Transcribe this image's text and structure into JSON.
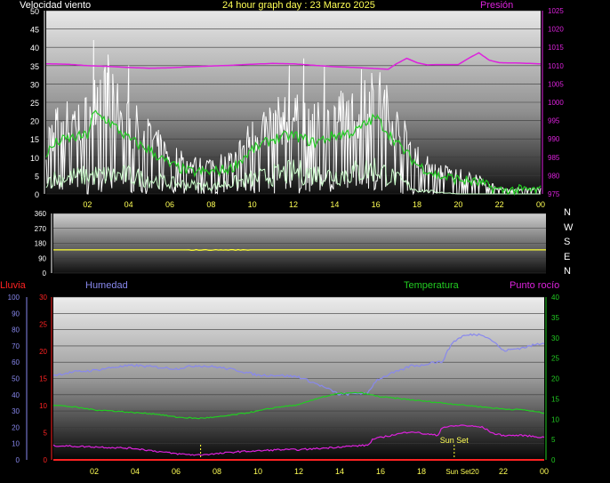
{
  "header": {
    "left": "Velocidad viento",
    "center": "24 hour graph day : 23 Marzo 2025",
    "right": "Presión"
  },
  "direction_letters": [
    "N",
    "W",
    "S",
    "E",
    "N"
  ],
  "bottom_labels": {
    "rain": "Lluvia",
    "humidity": "Humedad",
    "temperature": "Temperatura",
    "dewpoint": "Punto rocío",
    "sunset": "Sun Set",
    "sunset_axis": "Sun Set20"
  },
  "colors": {
    "wind_gust": "#ffffff",
    "wind_avg": "#22cc22",
    "wind_low": "#ccffcc",
    "pressure": "#dd22dd",
    "direction": "#ffff33",
    "humidity": "#8888ee",
    "temperature": "#22cc22",
    "dewpoint": "#dd22dd",
    "rain": "#ff2222"
  },
  "chart_data": [
    {
      "type": "line",
      "name": "wind-pressure",
      "x_ticks": [
        "02",
        "04",
        "06",
        "08",
        "10",
        "12",
        "14",
        "16",
        "18",
        "20",
        "22",
        "00"
      ],
      "y_left_ticks": [
        "0",
        "5",
        "10",
        "15",
        "20",
        "25",
        "30",
        "35",
        "40",
        "45",
        "50"
      ],
      "y_left_range": [
        0,
        50
      ],
      "y_right_ticks": [
        "975",
        "980",
        "985",
        "990",
        "995",
        "1000",
        "1005",
        "1010",
        "1015",
        "1020",
        "1025"
      ],
      "y_right_range": [
        975,
        1025
      ],
      "x_range": [
        0,
        24
      ],
      "gust_peaks": [
        [
          2.3,
          42
        ],
        [
          3.0,
          38
        ],
        [
          4.0,
          35
        ],
        [
          11.8,
          35
        ],
        [
          12.5,
          37
        ],
        [
          13.5,
          35
        ],
        [
          15.3,
          34
        ],
        [
          15.8,
          33
        ]
      ],
      "wind_avg": [
        [
          0,
          11
        ],
        [
          0.5,
          14
        ],
        [
          1,
          15
        ],
        [
          2,
          16
        ],
        [
          2.3,
          22
        ],
        [
          3,
          20
        ],
        [
          4,
          15
        ],
        [
          5,
          12
        ],
        [
          6,
          8
        ],
        [
          7,
          6
        ],
        [
          8,
          6
        ],
        [
          9,
          7
        ],
        [
          10,
          12
        ],
        [
          11,
          15
        ],
        [
          12,
          16
        ],
        [
          13,
          14
        ],
        [
          14,
          16
        ],
        [
          15,
          17
        ],
        [
          16,
          21
        ],
        [
          17,
          14
        ],
        [
          18,
          8
        ],
        [
          19,
          5
        ],
        [
          20,
          4
        ],
        [
          21,
          3
        ],
        [
          22,
          1
        ],
        [
          23,
          1
        ],
        [
          24,
          1
        ]
      ],
      "wind_low": [
        [
          0,
          4
        ],
        [
          2,
          5
        ],
        [
          4,
          5
        ],
        [
          6,
          3
        ],
        [
          8,
          2
        ],
        [
          10,
          4
        ],
        [
          12,
          6
        ],
        [
          14,
          5
        ],
        [
          16,
          7
        ],
        [
          18,
          1
        ],
        [
          20,
          0
        ],
        [
          22,
          0
        ],
        [
          24,
          0
        ]
      ],
      "pressure": [
        [
          0,
          1010.5
        ],
        [
          1,
          1010.4
        ],
        [
          2,
          1010
        ],
        [
          3,
          1009.8
        ],
        [
          4,
          1009.5
        ],
        [
          5,
          1009.3
        ],
        [
          6,
          1009.4
        ],
        [
          7,
          1009.7
        ],
        [
          8,
          1009.9
        ],
        [
          9,
          1010.1
        ],
        [
          10,
          1010.4
        ],
        [
          11,
          1010.6
        ],
        [
          12,
          1010.5
        ],
        [
          13,
          1010.1
        ],
        [
          14,
          1009.7
        ],
        [
          15,
          1009.5
        ],
        [
          16,
          1009.2
        ],
        [
          16.6,
          1009
        ],
        [
          17,
          1010.5
        ],
        [
          17.5,
          1012
        ],
        [
          18,
          1010.8
        ],
        [
          18.5,
          1010.2
        ],
        [
          19,
          1010.3
        ],
        [
          20,
          1010.3
        ],
        [
          20.5,
          1012
        ],
        [
          21,
          1013.5
        ],
        [
          21.5,
          1011.5
        ],
        [
          22,
          1010.8
        ],
        [
          23,
          1010.7
        ],
        [
          24,
          1010.5
        ]
      ]
    },
    {
      "type": "line",
      "name": "wind-direction",
      "y_ticks": [
        "0",
        "90",
        "180",
        "270",
        "360"
      ],
      "y_range": [
        0,
        360
      ],
      "x_range": [
        0,
        24
      ],
      "direction": [
        [
          0,
          140
        ],
        [
          24,
          140
        ]
      ]
    },
    {
      "type": "line",
      "name": "humidity-temperature",
      "x_ticks": [
        "02",
        "04",
        "06",
        "08",
        "10",
        "12",
        "14",
        "16",
        "18",
        "22",
        "00"
      ],
      "x_tick_positions": [
        2,
        4,
        6,
        8,
        10,
        12,
        14,
        16,
        18,
        22,
        24
      ],
      "x_range": [
        0,
        24
      ],
      "y_left_rain_ticks": [
        "0",
        "5",
        "10",
        "15",
        "20",
        "25",
        "30"
      ],
      "y_left_rain_range": [
        0,
        30
      ],
      "y_left_humidity_ticks": [
        "0",
        "10",
        "20",
        "30",
        "40",
        "50",
        "60",
        "70",
        "80",
        "90",
        "100"
      ],
      "y_left_humidity_range": [
        0,
        100
      ],
      "y_right_ticks": [
        "0",
        "5",
        "10",
        "15",
        "20",
        "25",
        "30",
        "35",
        "40"
      ],
      "y_right_range": [
        0,
        40
      ],
      "sunset_hour": 19.6,
      "marker_hour": 7.2,
      "humidity": [
        [
          0,
          52
        ],
        [
          1,
          54
        ],
        [
          2,
          55
        ],
        [
          3,
          57
        ],
        [
          4,
          58
        ],
        [
          5,
          57
        ],
        [
          6,
          56
        ],
        [
          7,
          58
        ],
        [
          8,
          57
        ],
        [
          9,
          55
        ],
        [
          10,
          52
        ],
        [
          11,
          52
        ],
        [
          12,
          51
        ],
        [
          13,
          46
        ],
        [
          13.7,
          42
        ],
        [
          14,
          40
        ],
        [
          15,
          41
        ],
        [
          15.3,
          40
        ],
        [
          15.8,
          49
        ],
        [
          16.5,
          53
        ],
        [
          17,
          55
        ],
        [
          17.5,
          58
        ],
        [
          18,
          58
        ],
        [
          18.5,
          60
        ],
        [
          19,
          60
        ],
        [
          19.5,
          72
        ],
        [
          20,
          76
        ],
        [
          20.5,
          77
        ],
        [
          21,
          77
        ],
        [
          21.5,
          73
        ],
        [
          22,
          67
        ],
        [
          23,
          69
        ],
        [
          24,
          72
        ]
      ],
      "temperature": [
        [
          0,
          13.5
        ],
        [
          1,
          13
        ],
        [
          2,
          12.3
        ],
        [
          3,
          12
        ],
        [
          4,
          11.6
        ],
        [
          5,
          11.3
        ],
        [
          6,
          10.5
        ],
        [
          7,
          10.2
        ],
        [
          8,
          10.5
        ],
        [
          9,
          11.2
        ],
        [
          10,
          12
        ],
        [
          11,
          13
        ],
        [
          12,
          13.5
        ],
        [
          13,
          15.3
        ],
        [
          14,
          16.3
        ],
        [
          15,
          16.5
        ],
        [
          16,
          15.5
        ],
        [
          17,
          15
        ],
        [
          18,
          14.5
        ],
        [
          19,
          14
        ],
        [
          20,
          13.5
        ],
        [
          21,
          13
        ],
        [
          22,
          12.5
        ],
        [
          23,
          12.3
        ],
        [
          24,
          11.5
        ]
      ],
      "dewpoint": [
        [
          0,
          3.5
        ],
        [
          2,
          3.2
        ],
        [
          4,
          2.8
        ],
        [
          6,
          1.5
        ],
        [
          7,
          1.2
        ],
        [
          8,
          1.5
        ],
        [
          9,
          2
        ],
        [
          10,
          2.2
        ],
        [
          11,
          2.5
        ],
        [
          12,
          2.5
        ],
        [
          13,
          2.8
        ],
        [
          14,
          3.2
        ],
        [
          15,
          3.5
        ],
        [
          15.4,
          3.6
        ],
        [
          15.6,
          5
        ],
        [
          16,
          5.5
        ],
        [
          17,
          6.5
        ],
        [
          17.5,
          7
        ],
        [
          18,
          6.5
        ],
        [
          18.8,
          6
        ],
        [
          19,
          8
        ],
        [
          20,
          8.5
        ],
        [
          21,
          8
        ],
        [
          21.5,
          6.5
        ],
        [
          22,
          6
        ],
        [
          23,
          6
        ],
        [
          24,
          5.5
        ]
      ],
      "rain": [
        [
          0,
          0
        ],
        [
          24,
          0
        ]
      ]
    }
  ]
}
